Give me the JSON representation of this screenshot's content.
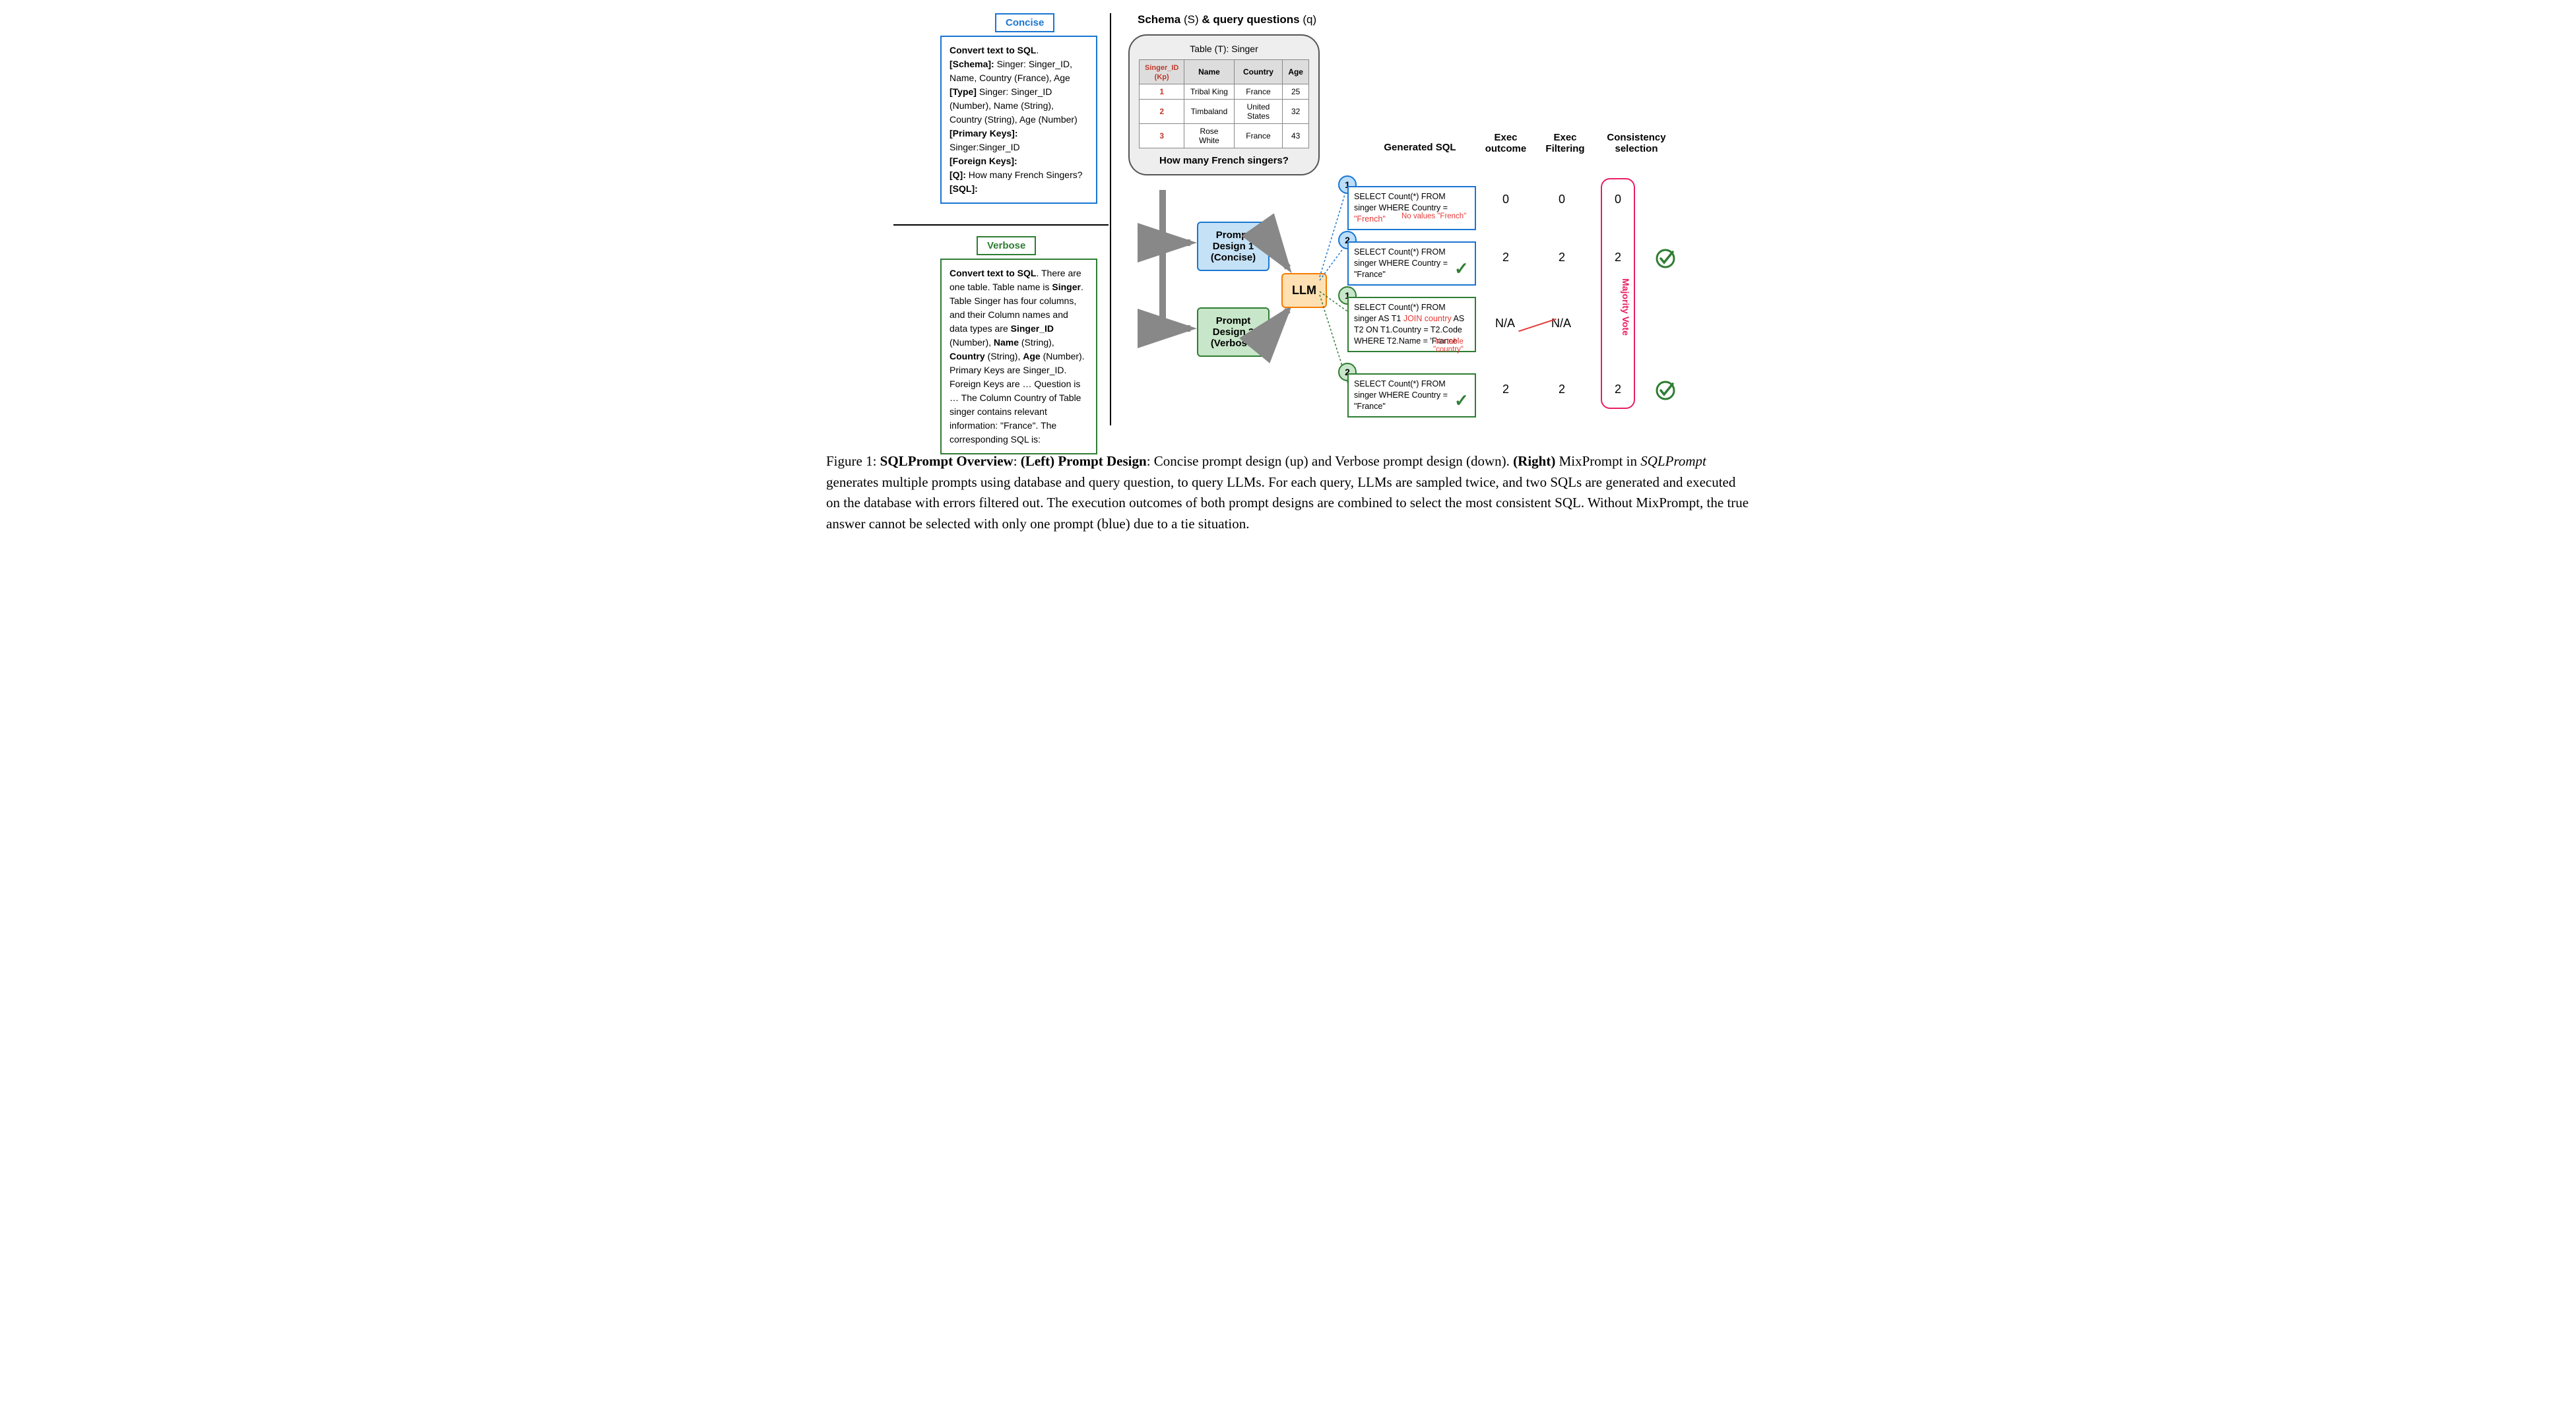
{
  "tags": {
    "concise": "Concise",
    "verbose": "Verbose"
  },
  "concise_box": {
    "line1_b": "Convert text to SQL",
    "line1_r": ".",
    "schema_b": "[Schema]:",
    "schema_v": " Singer: Singer_ID, Name, Country (France), Age",
    "type_b": "[Type]",
    "type_v": " Singer: Singer_ID (Number), Name (String), Country (String), Age (Number)",
    "pk_b": "[Primary Keys]:",
    "pk_v": "Singer:Singer_ID",
    "fk_b": "[Foreign Keys]:",
    "q_b": "[Q]:",
    "q_v": " How many French Singers?",
    "sql_b": "[SQL]:"
  },
  "verbose_box": {
    "l1_b": "Convert text to SQL",
    "l1_r": ". There are one table. Table name is ",
    "l2_b": "Singer",
    "l2_r": ". Table Singer has four columns, and their Column names and data types are ",
    "l3_b": "Singer_ID",
    "l3_r": " (Number), ",
    "l4_b": "Name",
    "l4_r": " (String),  ",
    "l5_b": "Country",
    "l5_r": " (String), ",
    "l6_b": "Age",
    "l6_r": " (Number). Primary Keys are Singer_ID. Foreign Keys are … Question is … The Column Country of Table singer contains relevant information: \"France\". The corresponding SQL is:"
  },
  "schema_header": {
    "b": "Schema ",
    "s": "(S)",
    "amp": " & query questions ",
    "q": "(q)"
  },
  "table": {
    "caption": "Table (T): Singer",
    "headers": {
      "pk1": "Singer_ID",
      "pk2": "(Kp)",
      "name": "Name",
      "country": "Country",
      "age": "Age"
    },
    "r1": {
      "id": "1",
      "name": "Tribal King",
      "country": "France",
      "age": "25"
    },
    "r2": {
      "id": "2",
      "name": "Timbaland",
      "country": "United States",
      "age": "32"
    },
    "r3": {
      "id": "3",
      "name": "Rose White",
      "country": "France",
      "age": "43"
    }
  },
  "question": "How many French singers?",
  "pd1": {
    "l1": "Prompt",
    "l2": "Design 1",
    "l3": "(Concise)"
  },
  "pd2": {
    "l1": "Prompt",
    "l2": "Design 2",
    "l3": "(Verbose)"
  },
  "llm": "LLM",
  "cols": {
    "gen": "Generated SQL",
    "exec": "Exec outcome",
    "filter": "Exec Filtering",
    "cons": "Consistency selection"
  },
  "sql1": {
    "a": "SELECT Count(*) FROM singer WHERE Country = ",
    "b": "\"French\""
  },
  "note1": "No values \"French\"",
  "sql2": "SELECT Count(*) FROM singer WHERE Country = \"France\"",
  "sql3": {
    "a": "SELECT Count(*) FROM singer AS T1 ",
    "b": "JOIN country",
    "c": " AS T2 ON T1.Country = T2.Code WHERE T2.Name = 'France'"
  },
  "note3a": "No table",
  "note3b": "\"country\"",
  "sql4": "SELECT Count(*) FROM singer WHERE Country = \"France\"",
  "nums": {
    "n1": "1",
    "n2": "2"
  },
  "vals": {
    "zero": "0",
    "two": "2",
    "na": "N/A"
  },
  "mv": "Majority Vote",
  "caption": {
    "p1a": "Figure 1: ",
    "p1b": "SQLPrompt Overview",
    "p1c": ": ",
    "p1d": "(Left) Prompt Design",
    "p1e": ": Concise prompt design (up) and Verbose prompt design (down). ",
    "p1f": "(Right)",
    "p1g": " MixPrompt in ",
    "p1h": "SQLPrompt",
    "p1i": " generates multiple prompts using database and query question, to query LLMs. For each query, LLMs are sampled twice, and two SQLs are generated and executed on the database with errors filtered out. The execution outcomes of both prompt designs are combined to select the most consistent SQL. Without MixPrompt, the true answer cannot be selected with only one prompt (blue) due to a tie situation."
  }
}
